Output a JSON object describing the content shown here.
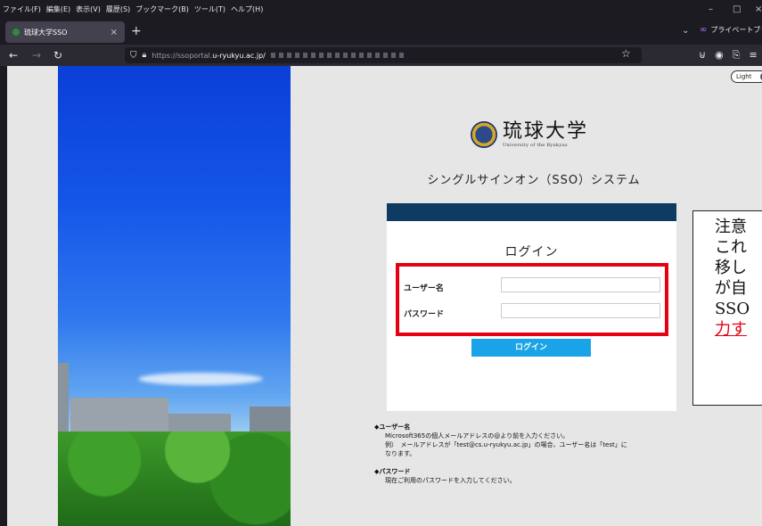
{
  "menubar": {
    "items": [
      "ファイル(F)",
      "編集(E)",
      "表示(V)",
      "履歴(S)",
      "ブックマーク(B)",
      "ツール(T)",
      "ヘルプ(H)"
    ]
  },
  "tab": {
    "title": "琉球大学SSO",
    "close": "×"
  },
  "newtab": "+",
  "private_label": "プライベートブラウジング",
  "url": {
    "host": "https://ssoportal.",
    "domain": "u-ryukyu.ac.jp/"
  },
  "page": {
    "theme_toggle": "Light",
    "logo_jp": "琉球大学",
    "logo_en": "University of the Ryukyus",
    "system_title": "シングルサインオン（SSO）システム",
    "login_title": "ログイン",
    "username_label": "ユーザー名",
    "password_label": "パスワード",
    "login_button": "ログイン",
    "help": {
      "user_head": "◆ユーザー名",
      "user_line1": "Microsoft365の個人メールアドレスの@より前を入力ください。",
      "user_line2": "例）　メールアドレスが「test@cs.u-ryukyu.ac.jp」の場合、ユーザー名は「test」に",
      "user_line3": "なります。",
      "pass_head": "◆パスワード",
      "pass_line1": "現在ご利用のパスワードを入力してください。"
    }
  },
  "note": {
    "line1": "注意",
    "line2": "これ",
    "line3": "移し",
    "line4": "が自",
    "line5": "SSO",
    "line6": "力す"
  },
  "colors": {
    "header_bar": "#0d3b61",
    "login_button": "#1aa3e8",
    "highlight": "#e60012"
  }
}
